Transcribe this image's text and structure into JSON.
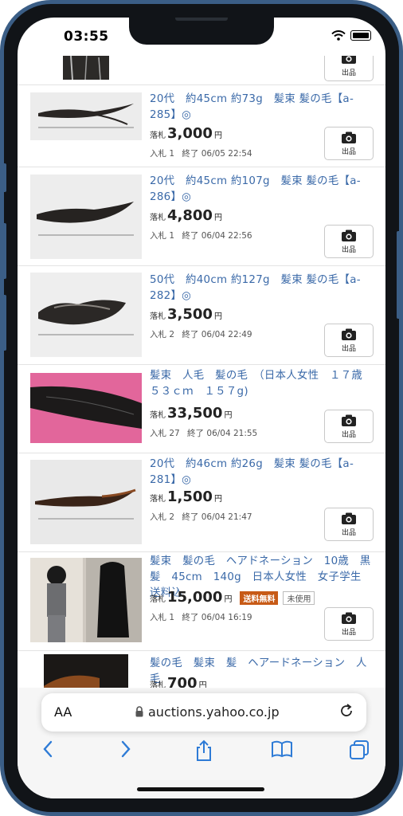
{
  "status": {
    "time": "03:55"
  },
  "items": [
    {
      "title": "",
      "price_label": "",
      "price": "",
      "yen": "",
      "bids": "",
      "end": "",
      "camera_label": "出品"
    },
    {
      "title": "20代　約45cm 約73g　髪束 髪の毛【a-285】◎",
      "price_label": "落札",
      "price": "3,000",
      "yen": "円",
      "bids": "入札 1",
      "end": "終了 06/05 22:54",
      "camera_label": "出品"
    },
    {
      "title": "20代　約45cm 約107g　髪束 髪の毛【a-286】◎",
      "price_label": "落札",
      "price": "4,800",
      "yen": "円",
      "bids": "入札 1",
      "end": "終了 06/04 22:56",
      "camera_label": "出品"
    },
    {
      "title": "50代　約40cm 約127g　髪束 髪の毛【a-282】◎",
      "price_label": "落札",
      "price": "3,500",
      "yen": "円",
      "bids": "入札 2",
      "end": "終了 06/04 22:49",
      "camera_label": "出品"
    },
    {
      "title": "髪束　人毛　髪の毛　（日本人女性　１７歳　５３ｃｍ　１５７g)",
      "price_label": "落札",
      "price": "33,500",
      "yen": "円",
      "bids": "入札 27",
      "end": "終了 06/04 21:55",
      "camera_label": "出品"
    },
    {
      "title": "20代　約46cm 約26g　髪束 髪の毛【a-281】◎",
      "price_label": "落札",
      "price": "1,500",
      "yen": "円",
      "bids": "入札 2",
      "end": "終了 06/04 21:47",
      "camera_label": "出品"
    },
    {
      "title": "髪束　髪の毛　ヘアドネーション　10歳　黒髪　45cm　140g　日本人女性　女子学生　送料込",
      "price_label": "落札",
      "price": "15,000",
      "yen": "円",
      "badge_free": "送料無料",
      "badge_unused": "未使用",
      "bids": "入札 1",
      "end": "終了 06/04 16:19",
      "camera_label": "出品"
    },
    {
      "title": "髪の毛　髪束　髪　ヘアードネーション　人毛",
      "price_label": "落札",
      "price": "700",
      "yen": "円",
      "bids": "",
      "end": "",
      "camera_label": ""
    }
  ],
  "browser": {
    "aa": "AA",
    "url": "auctions.yahoo.co.jp"
  },
  "icons": [
    "wifi-icon",
    "battery-icon",
    "camera-icon",
    "lock-icon",
    "reload-icon",
    "back-icon",
    "forward-icon",
    "share-icon",
    "bookmarks-icon",
    "tabs-icon"
  ]
}
